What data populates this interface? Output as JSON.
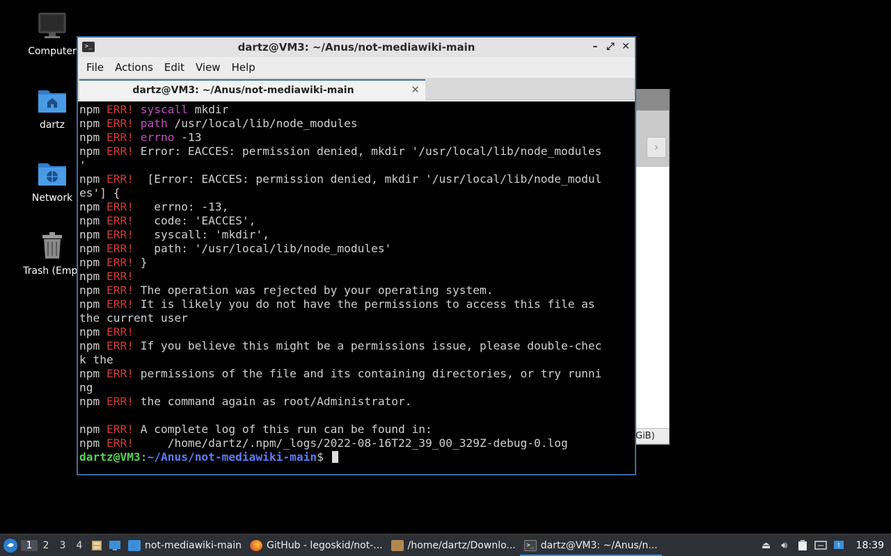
{
  "desktop": {
    "icons": [
      {
        "label": "Computer",
        "icon": "monitor-icon"
      },
      {
        "label": "dartz",
        "icon": "home-folder-icon"
      },
      {
        "label": "Network",
        "icon": "network-folder-icon"
      },
      {
        "label": "Trash (Empt",
        "icon": "trash-icon"
      }
    ]
  },
  "background_window": {
    "nav_glyph": "›",
    "status_text": "GiB)"
  },
  "terminal": {
    "title": "dartz@VM3: ~/Anus/not-mediawiki-main",
    "menu": [
      "File",
      "Actions",
      "Edit",
      "View",
      "Help"
    ],
    "tab_title": "dartz@VM3: ~/Anus/not-mediawiki-main",
    "tab_close": "✕",
    "lines": [
      [
        {
          "t": "npm ",
          "c": ""
        },
        {
          "t": "ERR!",
          "c": "err"
        },
        {
          "t": " ",
          "c": ""
        },
        {
          "t": "syscall",
          "c": "kw"
        },
        {
          "t": " mkdir",
          "c": ""
        }
      ],
      [
        {
          "t": "npm ",
          "c": ""
        },
        {
          "t": "ERR!",
          "c": "err"
        },
        {
          "t": " ",
          "c": ""
        },
        {
          "t": "path",
          "c": "kw"
        },
        {
          "t": " /usr/local/lib/node_modules",
          "c": ""
        }
      ],
      [
        {
          "t": "npm ",
          "c": ""
        },
        {
          "t": "ERR!",
          "c": "err"
        },
        {
          "t": " ",
          "c": ""
        },
        {
          "t": "errno",
          "c": "kw"
        },
        {
          "t": " -13",
          "c": ""
        }
      ],
      [
        {
          "t": "npm ",
          "c": ""
        },
        {
          "t": "ERR!",
          "c": "err"
        },
        {
          "t": " Error: EACCES: permission denied, mkdir '/usr/local/lib/node_modules",
          "c": ""
        }
      ],
      [
        {
          "t": "'",
          "c": ""
        }
      ],
      [
        {
          "t": "npm ",
          "c": ""
        },
        {
          "t": "ERR!",
          "c": "err"
        },
        {
          "t": "  [Error: EACCES: permission denied, mkdir '/usr/local/lib/node_modul",
          "c": ""
        }
      ],
      [
        {
          "t": "es'] {",
          "c": ""
        }
      ],
      [
        {
          "t": "npm ",
          "c": ""
        },
        {
          "t": "ERR!",
          "c": "err"
        },
        {
          "t": "   errno: -13,",
          "c": ""
        }
      ],
      [
        {
          "t": "npm ",
          "c": ""
        },
        {
          "t": "ERR!",
          "c": "err"
        },
        {
          "t": "   code: 'EACCES',",
          "c": ""
        }
      ],
      [
        {
          "t": "npm ",
          "c": ""
        },
        {
          "t": "ERR!",
          "c": "err"
        },
        {
          "t": "   syscall: 'mkdir',",
          "c": ""
        }
      ],
      [
        {
          "t": "npm ",
          "c": ""
        },
        {
          "t": "ERR!",
          "c": "err"
        },
        {
          "t": "   path: '/usr/local/lib/node_modules'",
          "c": ""
        }
      ],
      [
        {
          "t": "npm ",
          "c": ""
        },
        {
          "t": "ERR!",
          "c": "err"
        },
        {
          "t": " }",
          "c": ""
        }
      ],
      [
        {
          "t": "npm ",
          "c": ""
        },
        {
          "t": "ERR!",
          "c": "err"
        }
      ],
      [
        {
          "t": "npm ",
          "c": ""
        },
        {
          "t": "ERR!",
          "c": "err"
        },
        {
          "t": " The operation was rejected by your operating system.",
          "c": ""
        }
      ],
      [
        {
          "t": "npm ",
          "c": ""
        },
        {
          "t": "ERR!",
          "c": "err"
        },
        {
          "t": " It is likely you do not have the permissions to access this file as",
          "c": ""
        }
      ],
      [
        {
          "t": "the current user",
          "c": ""
        }
      ],
      [
        {
          "t": "npm ",
          "c": ""
        },
        {
          "t": "ERR!",
          "c": "err"
        }
      ],
      [
        {
          "t": "npm ",
          "c": ""
        },
        {
          "t": "ERR!",
          "c": "err"
        },
        {
          "t": " If you believe this might be a permissions issue, please double-chec",
          "c": ""
        }
      ],
      [
        {
          "t": "k the",
          "c": ""
        }
      ],
      [
        {
          "t": "npm ",
          "c": ""
        },
        {
          "t": "ERR!",
          "c": "err"
        },
        {
          "t": " permissions of the file and its containing directories, or try runni",
          "c": ""
        }
      ],
      [
        {
          "t": "ng",
          "c": ""
        }
      ],
      [
        {
          "t": "npm ",
          "c": ""
        },
        {
          "t": "ERR!",
          "c": "err"
        },
        {
          "t": " the command again as root/Administrator.",
          "c": ""
        }
      ],
      [],
      [
        {
          "t": "npm ",
          "c": ""
        },
        {
          "t": "ERR!",
          "c": "err"
        },
        {
          "t": " A complete log of this run can be found in:",
          "c": ""
        }
      ],
      [
        {
          "t": "npm ",
          "c": ""
        },
        {
          "t": "ERR!",
          "c": "err"
        },
        {
          "t": "     /home/dartz/.npm/_logs/2022-08-16T22_39_00_329Z-debug-0.log",
          "c": ""
        }
      ]
    ],
    "prompt_user": "dartz@VM3",
    "prompt_sep": ":",
    "prompt_path": "~/Anus/not-mediawiki-main",
    "prompt_symbol": "$ "
  },
  "taskbar": {
    "workspaces": [
      "1",
      "2",
      "3",
      "4"
    ],
    "active_workspace": "1",
    "tasks": [
      {
        "label": "not-mediawiki-main",
        "icon": "folder-icon",
        "color": "#3b8fd9"
      },
      {
        "label": "GitHub - legoskid/not-...",
        "icon": "firefox-icon",
        "color": "#e8672a"
      },
      {
        "label": "/home/dartz/Downlo...",
        "icon": "archive-icon",
        "color": "#b08850"
      },
      {
        "label": "dartz@VM3: ~/Anus/n...",
        "icon": "terminal-icon",
        "color": "#333"
      }
    ],
    "clock": "18:39"
  },
  "colors": {
    "accent": "#3a6ea5",
    "error_red": "#d33a3a",
    "keyword_magenta": "#c050c0",
    "prompt_green": "#55d155",
    "prompt_blue": "#5b7bff"
  }
}
